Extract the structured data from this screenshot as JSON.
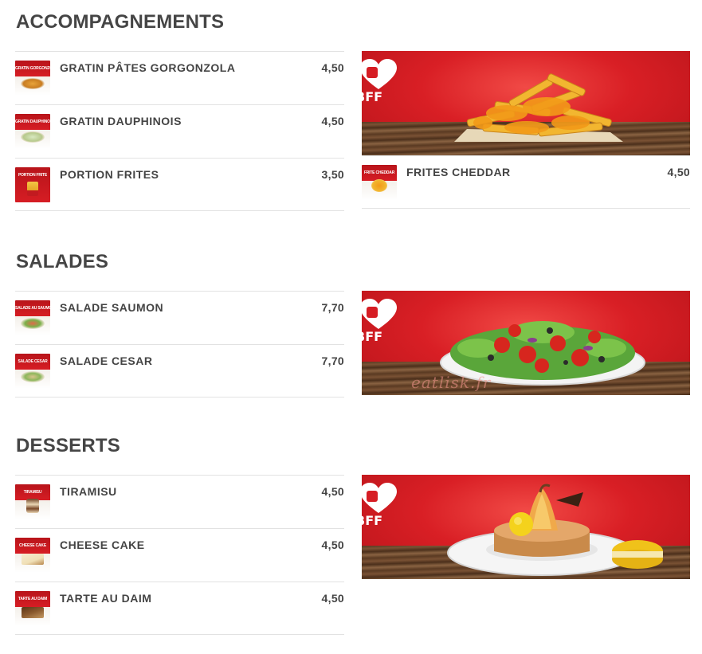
{
  "sections": [
    {
      "title": "ACCOMPAGNEMENTS",
      "left_items": [
        {
          "name": "GRATIN PÂTES GORGONZOLA",
          "price": "4,50",
          "thumb_label": "GRATIN GORGONZOLA"
        },
        {
          "name": "GRATIN DAUPHINOIS",
          "price": "4,50",
          "thumb_label": "GRATIN DAUPHINOIS"
        },
        {
          "name": "PORTION FRITES",
          "price": "3,50",
          "thumb_label": "PORTION FRITE"
        }
      ],
      "right_items": [
        {
          "name": "FRITES CHEDDAR",
          "price": "4,50",
          "thumb_label": "FRITE CHEDDAR"
        }
      ],
      "banner": {
        "logo": "BFF",
        "icon": "fries-cheddar-photo"
      }
    },
    {
      "title": "SALADES",
      "left_items": [
        {
          "name": "SALADE SAUMON",
          "price": "7,70",
          "thumb_label": "SALADE AU SAUMON"
        },
        {
          "name": "SALADE CESAR",
          "price": "7,70",
          "thumb_label": "SALADE CESAR"
        }
      ],
      "banner": {
        "logo": "BFF",
        "icon": "salad-photo",
        "watermark": "eatlisk.fr"
      }
    },
    {
      "title": "DESSERTS",
      "left_items": [
        {
          "name": "TIRAMISU",
          "price": "4,50",
          "thumb_label": "TIRAMISU"
        },
        {
          "name": "CHEESE CAKE",
          "price": "4,50",
          "thumb_label": "CHEESE CAKE"
        },
        {
          "name": "TARTE AU DAIM",
          "price": "4,50",
          "thumb_label": "TARTE AU DAIM"
        }
      ],
      "banner": {
        "logo": "BFF",
        "icon": "dessert-photo"
      }
    }
  ],
  "colors": {
    "brand_red": "#d61d24",
    "text": "#444444",
    "divider": "#e2e2e2"
  }
}
